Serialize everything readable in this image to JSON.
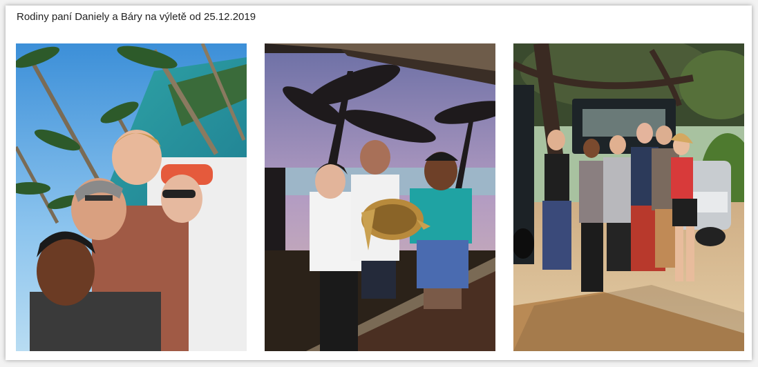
{
  "gallery": {
    "title": "Rodiny paní Daniely a Báry na výletě od 25.12.2019"
  },
  "colors": {
    "background": "#f2f2f2",
    "card": "#ffffff",
    "title_text": "#222222"
  },
  "photos": [
    {
      "name": "beach-selfie-photo"
    },
    {
      "name": "turtle-photo"
    },
    {
      "name": "group-jeep-photo"
    }
  ]
}
